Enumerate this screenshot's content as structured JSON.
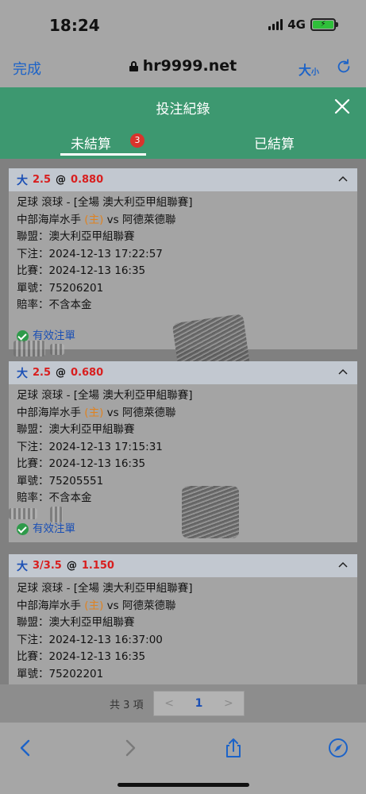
{
  "status": {
    "time": "18:24",
    "network": "4G"
  },
  "browser": {
    "done_label": "完成",
    "url": "hr9999.net",
    "text_size_big": "大",
    "text_size_small": "小"
  },
  "modal": {
    "title": "投注紀錄"
  },
  "tabs": [
    {
      "label": "未結算",
      "badge": "3",
      "active": true
    },
    {
      "label": "已結算",
      "active": false
    }
  ],
  "bets": [
    {
      "pick": "大",
      "line": "2.5",
      "at": "@",
      "odds": "0.880",
      "sport": "足球 滾球 - [全場 澳大利亞甲組聯賽]",
      "home": "中部海岸水手",
      "home_tag": "(主)",
      "vs": "vs",
      "away": "阿德萊德聯",
      "league": "聯盟：澳大利亞甲組聯賽",
      "placed": "下注：2024-12-13 17:22:57",
      "match": "比賽：2024-12-13 16:35",
      "ticket": "單號：75206201",
      "odds_type": "賠率：不含本金",
      "status": "有效注單"
    },
    {
      "pick": "大",
      "line": "2.5",
      "at": "@",
      "odds": "0.680",
      "sport": "足球 滾球 - [全場 澳大利亞甲組聯賽]",
      "home": "中部海岸水手",
      "home_tag": "(主)",
      "vs": "vs",
      "away": "阿德萊德聯",
      "league": "聯盟：澳大利亞甲組聯賽",
      "placed": "下注：2024-12-13 17:15:31",
      "match": "比賽：2024-12-13 16:35",
      "ticket": "單號：75205551",
      "odds_type": "賠率：不含本金",
      "status": "有效注單"
    },
    {
      "pick": "大",
      "line": "3/3.5",
      "at": "@",
      "odds": "1.150",
      "sport": "足球 滾球 - [全場 澳大利亞甲組聯賽]",
      "home": "中部海岸水手",
      "home_tag": "(主)",
      "vs": "vs",
      "away": "阿德萊德聯",
      "league": "聯盟：澳大利亞甲組聯賽",
      "placed": "下注：2024-12-13 16:37:00",
      "match": "比賽：2024-12-13 16:35",
      "ticket": "單號：75202201"
    }
  ],
  "pager": {
    "total": "共 3 項",
    "prev": "<",
    "page": "1",
    "next": ">"
  },
  "colors": {
    "accent_green": "#3d9870",
    "link_blue": "#1a4fb5",
    "odds_red": "#d81e1e",
    "home_orange": "#e0821f",
    "badge_red": "#d9332c"
  },
  "icons": [
    "lock-icon",
    "reload-icon",
    "close-icon",
    "chevron-up-icon",
    "check-icon",
    "back-icon",
    "forward-icon",
    "share-icon",
    "compass-icon"
  ]
}
